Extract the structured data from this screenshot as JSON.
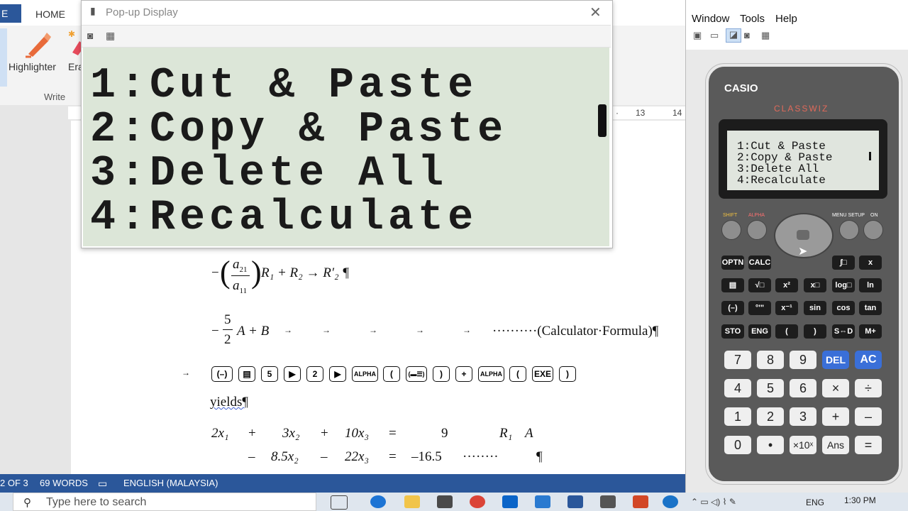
{
  "word": {
    "tabs": [
      "E",
      "HOME"
    ],
    "ribbon": {
      "highlighter": "Highlighter",
      "eraser": "Era",
      "group": "Write"
    },
    "ruler": {
      "mark13": "13",
      "mark14": "14"
    },
    "equations": {
      "frac_a21": "a",
      "frac_a21_sub": "21",
      "frac_a11": "a",
      "frac_a11_sub": "11",
      "row_op": "R₁ + R₂ → R′₂ ¶",
      "coef_num": "5",
      "coef_den": "2",
      "coef_expr": "A + B",
      "note": "··········(Calculator·Formula)¶",
      "yields": "yields¶",
      "eq1": [
        "2x₁",
        "+",
        "3x₂",
        "+",
        "10x₃",
        "=",
        "9",
        "R₁",
        "A"
      ],
      "eq2": [
        "–",
        "8.5x₂",
        "–",
        "22x₃",
        "=",
        "–16.5",
        "········",
        "¶"
      ]
    },
    "keyseq": [
      "(–)",
      "▤",
      "5",
      "▶",
      "2",
      "▶",
      "ALPHA",
      "(",
      "(▬☰)",
      ")",
      "+",
      "ALPHA",
      "(",
      "EXE",
      ")"
    ],
    "status": {
      "page": "2 OF 3",
      "words": "69 WORDS",
      "language": "ENGLISH (MALAYSIA)"
    }
  },
  "popup": {
    "title": "Pop-up Display",
    "lines": [
      "1:Cut & Paste",
      "2:Copy & Paste",
      "3:Delete All",
      "4:Recalculate"
    ]
  },
  "app": {
    "menu": [
      "Window",
      "Tools",
      "Help"
    ],
    "brand": "CASIO",
    "model": "CLASSWIZ",
    "screen": [
      "1:Cut & Paste",
      "2:Copy & Paste",
      "3:Delete All",
      "4:Recalculate"
    ],
    "top_labels": [
      "SHIFT",
      "ALPHA",
      "MENU SETUP",
      "ON"
    ],
    "func_rows": [
      [
        "OPTN",
        "CALC",
        "∫□",
        "x"
      ],
      [
        "▤",
        "√□",
        "x²",
        "x□",
        "log□",
        "ln"
      ],
      [
        "(–)",
        "°'\"",
        "x⁻¹",
        "sin",
        "cos",
        "tan"
      ],
      [
        "STO",
        "ENG",
        "(",
        ")",
        "S⇔D",
        "M+"
      ]
    ],
    "num_rows": [
      [
        "7",
        "8",
        "9",
        "DEL",
        "AC"
      ],
      [
        "4",
        "5",
        "6",
        "×",
        "÷"
      ],
      [
        "1",
        "2",
        "3",
        "+",
        "–"
      ],
      [
        "0",
        "•",
        "×10ˣ",
        "Ans",
        "="
      ]
    ]
  },
  "taskbar": {
    "search_placeholder": "Type here to search",
    "time": "1:30 PM",
    "lang": "ENG"
  }
}
